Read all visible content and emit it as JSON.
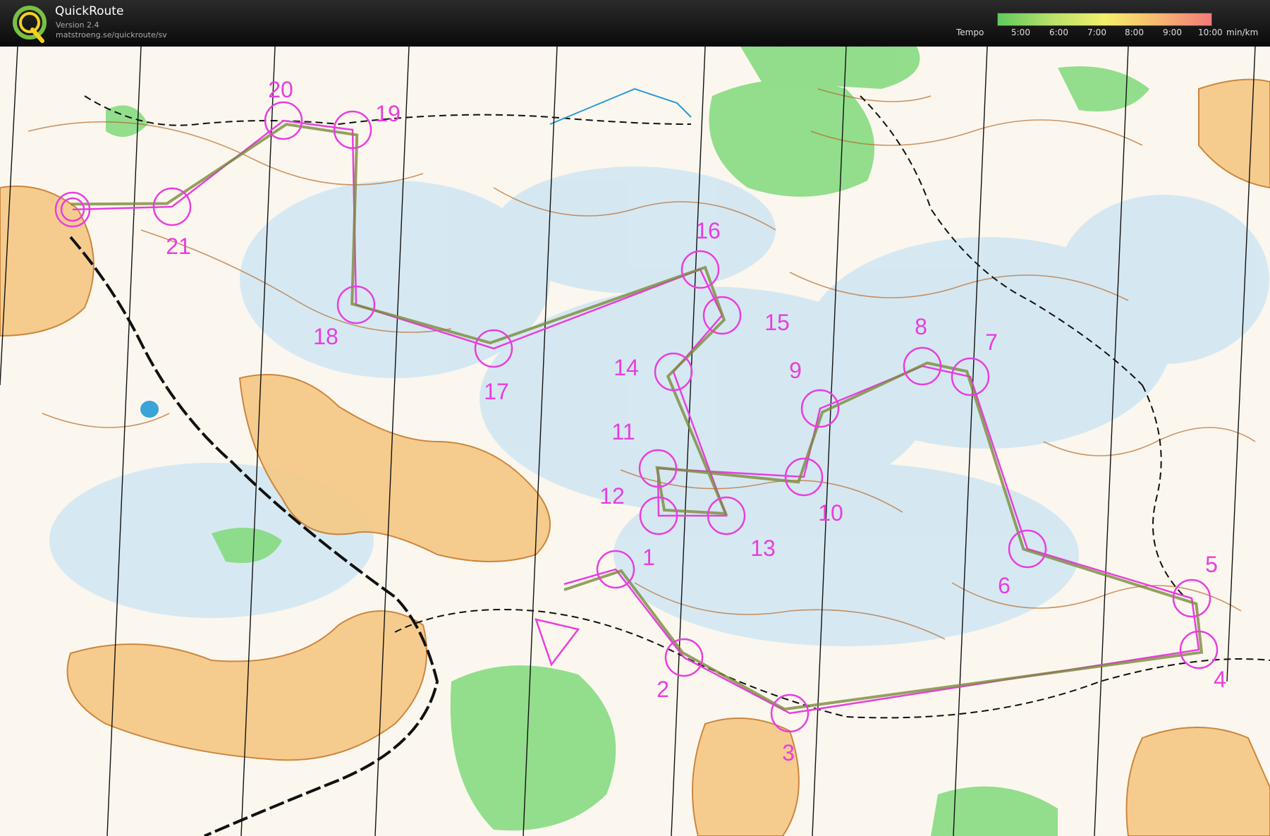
{
  "app": {
    "title": "QuickRoute",
    "version": "Version 2.4",
    "url": "matstroeng.se/quickroute/sv",
    "logo_letter": "Q"
  },
  "tempo": {
    "label": "Tempo",
    "ticks": [
      "5:00",
      "6:00",
      "7:00",
      "8:00",
      "9:00",
      "10:00"
    ],
    "unit": "min/km",
    "gradient_colors": [
      "#5fc95f",
      "#b8e06a",
      "#f3ef6a",
      "#f6b870",
      "#f27a7a"
    ]
  },
  "map": {
    "course_color": "#e83ee0",
    "route_color": "#7a8a3a",
    "controls": [
      {
        "label": "1"
      },
      {
        "label": "2"
      },
      {
        "label": "3"
      },
      {
        "label": "4"
      },
      {
        "label": "5"
      },
      {
        "label": "6"
      },
      {
        "label": "7"
      },
      {
        "label": "8"
      },
      {
        "label": "9"
      },
      {
        "label": "10"
      },
      {
        "label": "11"
      },
      {
        "label": "12"
      },
      {
        "label": "13"
      },
      {
        "label": "14"
      },
      {
        "label": "15"
      },
      {
        "label": "16"
      },
      {
        "label": "17"
      },
      {
        "label": "18"
      },
      {
        "label": "19"
      },
      {
        "label": "20"
      },
      {
        "label": "21"
      }
    ]
  }
}
